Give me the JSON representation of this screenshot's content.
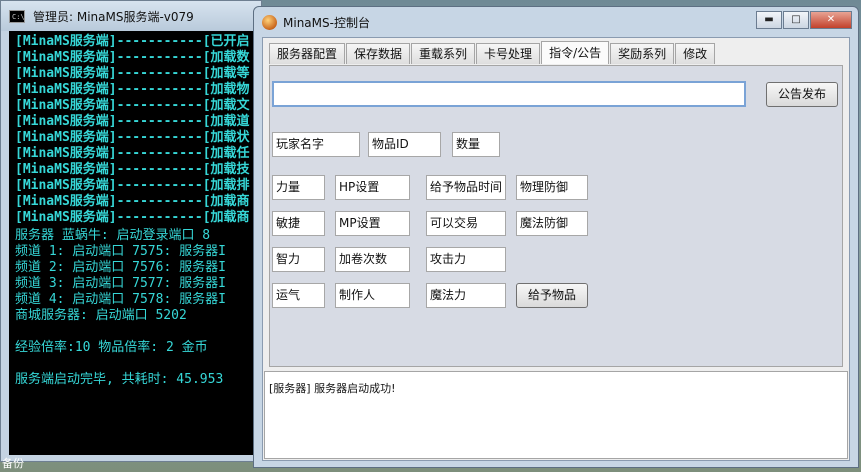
{
  "console": {
    "title": "管理员: MinaMS服务端-v079",
    "icon_text": "C:\\",
    "lines": [
      "[MinaMS服务端]-----------[已开启",
      "[MinaMS服务端]-----------[加载数",
      "[MinaMS服务端]-----------[加载等",
      "[MinaMS服务端]-----------[加载物",
      "[MinaMS服务端]-----------[加载文",
      "[MinaMS服务端]-----------[加载道",
      "[MinaMS服务端]-----------[加载状",
      "[MinaMS服务端]-----------[加载任",
      "[MinaMS服务端]-----------[加载技",
      "[MinaMS服务端]-----------[加载排",
      "[MinaMS服务端]-----------[加载商",
      "[MinaMS服务端]-----------[加载商",
      "服务器  蓝蜗牛: 启动登录端口 8",
      "频道 1: 启动端口 7575: 服务器I",
      "频道 2: 启动端口 7576: 服务器I",
      "频道 3: 启动端口 7577: 服务器I",
      "频道 4: 启动端口 7578: 服务器I",
      "商城服务器: 启动端口 5202",
      "经验倍率:10  物品倍率: 2  金币",
      "服务端启动完毕, 共耗时: 45.953"
    ],
    "status": "备份"
  },
  "window": {
    "title": "MinaMS-控制台",
    "minimize": "▬",
    "maximize": "□",
    "close": "✕"
  },
  "tabs": [
    "服务器配置",
    "保存数据",
    "重载系列",
    "卡号处理",
    "指令/公告",
    "奖励系列",
    "修改"
  ],
  "notice": {
    "value": "",
    "publish_button": "公告发布"
  },
  "fields": {
    "player_name": "玩家名字",
    "item_id": "物品ID",
    "quantity": "数量",
    "strength": "力量",
    "hp": "HP设置",
    "give_time": "给予物品时间",
    "phys_def": "物理防御",
    "dexterity": "敏捷",
    "mp": "MP设置",
    "tradeable": "可以交易",
    "magic_def": "魔法防御",
    "intelligence": "智力",
    "scroll_count": "加卷次数",
    "attack": "攻击力",
    "luck": "运气",
    "creator": "制作人",
    "magic_power": "魔法力"
  },
  "give_item_button": "给予物品",
  "log": "[服务器] 服务器启动成功!"
}
